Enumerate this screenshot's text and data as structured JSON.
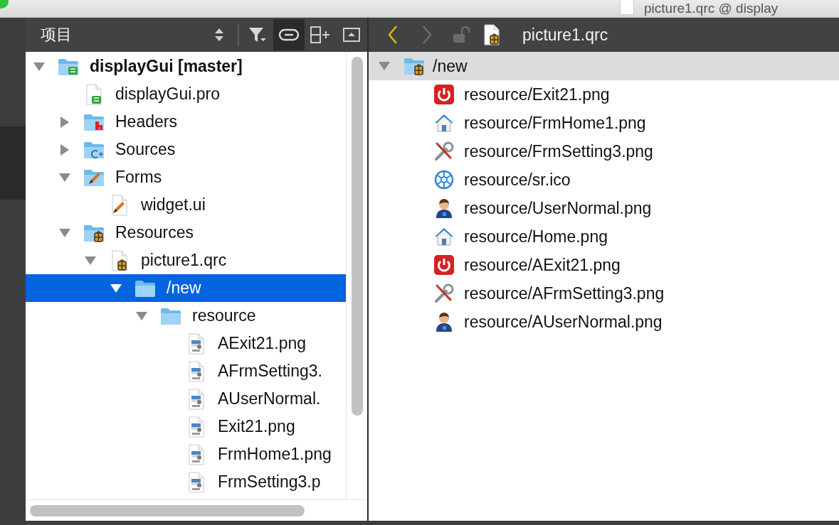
{
  "title_bar": {
    "title": "picture1.qrc @ display"
  },
  "project_pane": {
    "title": "项目",
    "tools": [
      {
        "kind": "sort",
        "on": false
      },
      {
        "kind": "filter",
        "on": false
      },
      {
        "kind": "link",
        "on": true
      },
      {
        "kind": "split",
        "on": false
      },
      {
        "kind": "hide",
        "on": false
      }
    ],
    "tree": [
      {
        "label": "displayGui [master]",
        "kind": "project",
        "expanded": true,
        "selected": false,
        "children": [
          {
            "label": "displayGui.pro",
            "kind": "pro",
            "selected": false
          },
          {
            "label": "Headers",
            "kind": "headers",
            "expanded": false,
            "selected": false
          },
          {
            "label": "Sources",
            "kind": "sources",
            "expanded": false,
            "selected": false
          },
          {
            "label": "Forms",
            "kind": "forms",
            "expanded": true,
            "selected": false,
            "children": [
              {
                "label": "widget.ui",
                "kind": "ui",
                "selected": false
              }
            ]
          },
          {
            "label": "Resources",
            "kind": "resources",
            "expanded": true,
            "selected": false,
            "children": [
              {
                "label": "picture1.qrc",
                "kind": "qrc",
                "expanded": true,
                "selected": false,
                "children": [
                  {
                    "label": "/new",
                    "kind": "folder",
                    "expanded": true,
                    "selected": true,
                    "children": [
                      {
                        "label": "resource",
                        "kind": "folder",
                        "expanded": true,
                        "selected": false,
                        "children": [
                          {
                            "label": "AExit21.png",
                            "kind": "png",
                            "selected": false
                          },
                          {
                            "label": "AFrmSetting3.",
                            "kind": "png",
                            "selected": false
                          },
                          {
                            "label": "AUserNormal.",
                            "kind": "png",
                            "selected": false
                          },
                          {
                            "label": "Exit21.png",
                            "kind": "png",
                            "selected": false
                          },
                          {
                            "label": "FrmHome1.png",
                            "kind": "png",
                            "selected": false
                          },
                          {
                            "label": "FrmSetting3.p",
                            "kind": "png",
                            "selected": false
                          }
                        ]
                      }
                    ]
                  }
                ]
              }
            ]
          }
        ]
      }
    ]
  },
  "editor": {
    "nav": [
      {
        "kind": "back",
        "disabled": false
      },
      {
        "kind": "forward",
        "disabled": true
      },
      {
        "kind": "lock",
        "disabled": true
      }
    ],
    "file_title": "picture1.qrc",
    "groups": [
      {
        "prefix": "/new",
        "expanded": true,
        "selected": true,
        "files": [
          {
            "path": "resource/Exit21.png",
            "kind": "power",
            "selected": false
          },
          {
            "path": "resource/FrmHome1.png",
            "kind": "home",
            "selected": false
          },
          {
            "path": "resource/FrmSetting3.png",
            "kind": "tools",
            "selected": false
          },
          {
            "path": "resource/sr.ico",
            "kind": "emblem",
            "selected": false
          },
          {
            "path": "resource/UserNormal.png",
            "kind": "user",
            "selected": false
          },
          {
            "path": "resource/Home.png",
            "kind": "home",
            "selected": false
          },
          {
            "path": "resource/AExit21.png",
            "kind": "power",
            "selected": false
          },
          {
            "path": "resource/AFrmSetting3.png",
            "kind": "tools",
            "selected": false
          },
          {
            "path": "resource/AUserNormal.png",
            "kind": "user",
            "selected": false
          }
        ]
      }
    ]
  }
}
